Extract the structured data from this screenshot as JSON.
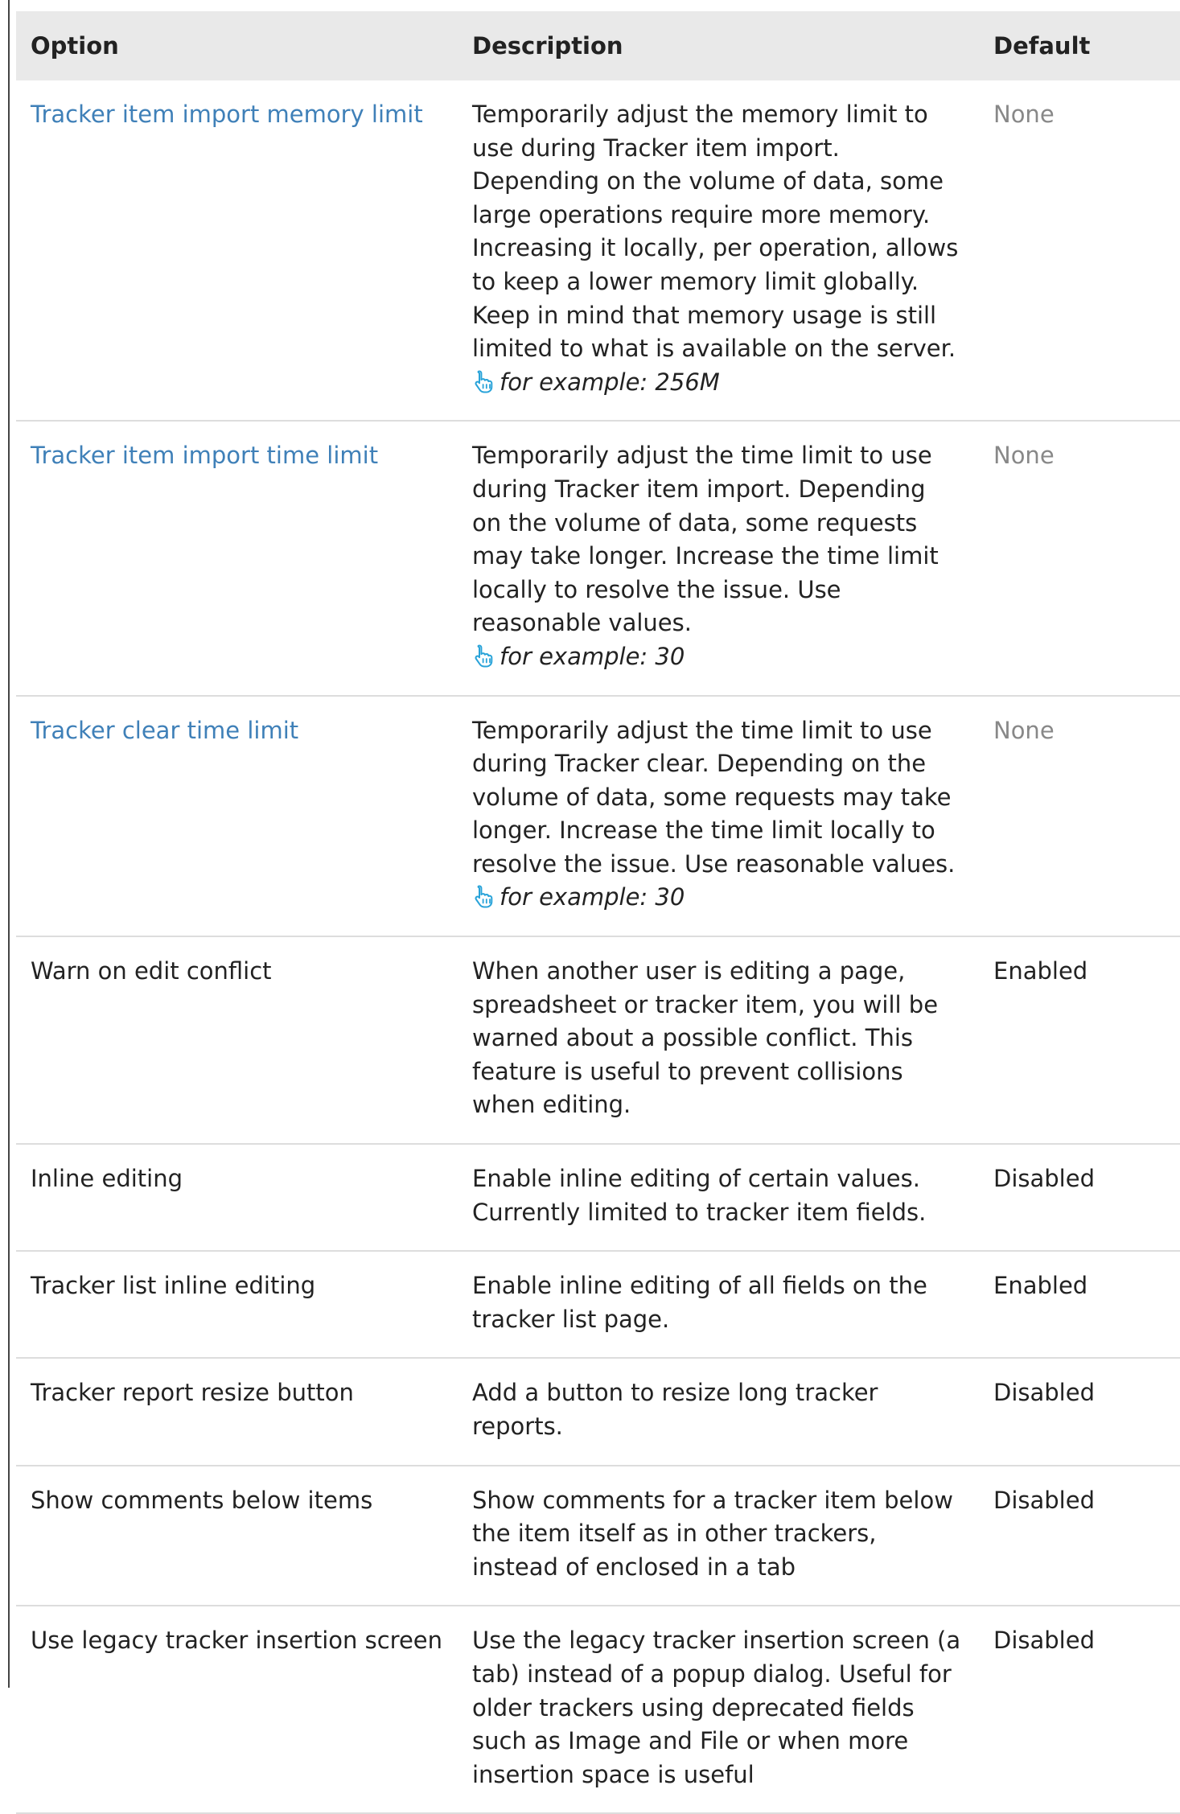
{
  "table": {
    "headers": {
      "option": "Option",
      "description": "Description",
      "default": "Default"
    },
    "rows": [
      {
        "option": "Tracker item import memory limit",
        "option_is_link": true,
        "description": "Temporarily adjust the memory limit to use during Tracker item import. Depending on the volume of data, some large operations require more memory. Increasing it locally, per operation, allows to keep a lower memory limit globally. Keep in mind that memory usage is still limited to what is available on the server.",
        "example": "for example: 256M",
        "default": "None",
        "default_muted": true
      },
      {
        "option": "Tracker item import time limit",
        "option_is_link": true,
        "description": "Temporarily adjust the time limit to use during Tracker item import. Depending on the volume of data, some requests may take longer. Increase the time limit locally to resolve the issue. Use reasonable values.",
        "example": "for example: 30",
        "default": "None",
        "default_muted": true
      },
      {
        "option": "Tracker clear time limit",
        "option_is_link": true,
        "description": "Temporarily adjust the time limit to use during Tracker clear. Depending on the volume of data, some requests may take longer. Increase the time limit locally to resolve the issue. Use reasonable values.",
        "example": "for example: 30",
        "default": "None",
        "default_muted": true
      },
      {
        "option": "Warn on edit conflict",
        "option_is_link": false,
        "description": "When another user is editing a page, spreadsheet or tracker item, you will be warned about a possible conflict. This feature is useful to prevent collisions when editing.",
        "default": "Enabled",
        "default_muted": false
      },
      {
        "option": "Inline editing",
        "option_is_link": false,
        "description": "Enable inline editing of certain values. Currently limited to tracker item fields.",
        "default": "Disabled",
        "default_muted": false
      },
      {
        "option": "Tracker list inline editing",
        "option_is_link": false,
        "description": "Enable inline editing of all fields on the tracker list page.",
        "default": "Enabled",
        "default_muted": false
      },
      {
        "option": "Tracker report resize button",
        "option_is_link": false,
        "description": "Add a button to resize long tracker reports.",
        "default": "Disabled",
        "default_muted": false
      },
      {
        "option": "Show comments below items",
        "option_is_link": false,
        "description": "Show comments for a tracker item below the item itself as in other trackers, instead of enclosed in a tab",
        "default": "Disabled",
        "default_muted": false
      },
      {
        "option": "Use legacy tracker insertion screen",
        "option_is_link": false,
        "description": "Use the legacy tracker insertion screen (a tab) instead of a popup dialog. Useful for older trackers using deprecated fields such as Image and File or when more insertion space is useful",
        "default": "Disabled",
        "default_muted": false
      }
    ]
  },
  "icons": {
    "example_icon": "pointing-hand-icon"
  },
  "colors": {
    "link": "#3f80b8",
    "muted_default": "#888888",
    "header_background": "#e9e9e9",
    "text": "#222222",
    "icon": "#29a3d9"
  }
}
